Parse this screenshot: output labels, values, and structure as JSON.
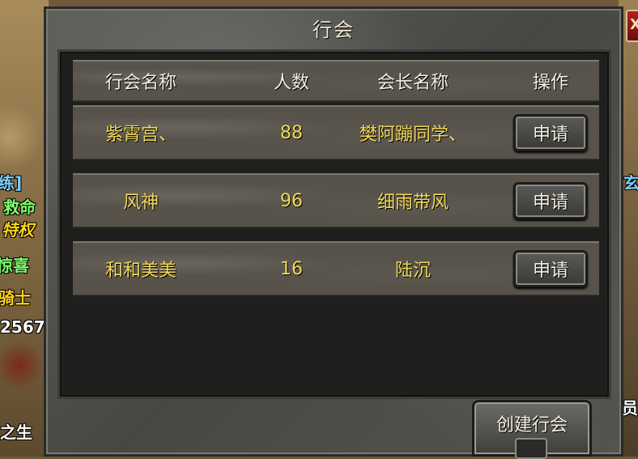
{
  "window": {
    "title": "行会",
    "close_label": "X"
  },
  "table": {
    "headers": {
      "name": "行会名称",
      "count": "人数",
      "leader": "会长名称",
      "op": "操作"
    },
    "rows": [
      {
        "name": "紫霄宫、",
        "count": "88",
        "leader": "樊阿蹦同学、",
        "action": "申请"
      },
      {
        "name": "风神",
        "count": "96",
        "leader": "细雨带风",
        "action": "申请"
      },
      {
        "name": "和和美美",
        "count": "16",
        "leader": "陆沉",
        "action": "申请"
      }
    ]
  },
  "create_button_label": "创建行会",
  "background": {
    "left_texts": [
      "练]",
      "救命",
      "特权",
      "惊喜",
      "骑士",
      "2567",
      "之生"
    ],
    "right_texts": [
      "玄",
      "员"
    ]
  }
}
